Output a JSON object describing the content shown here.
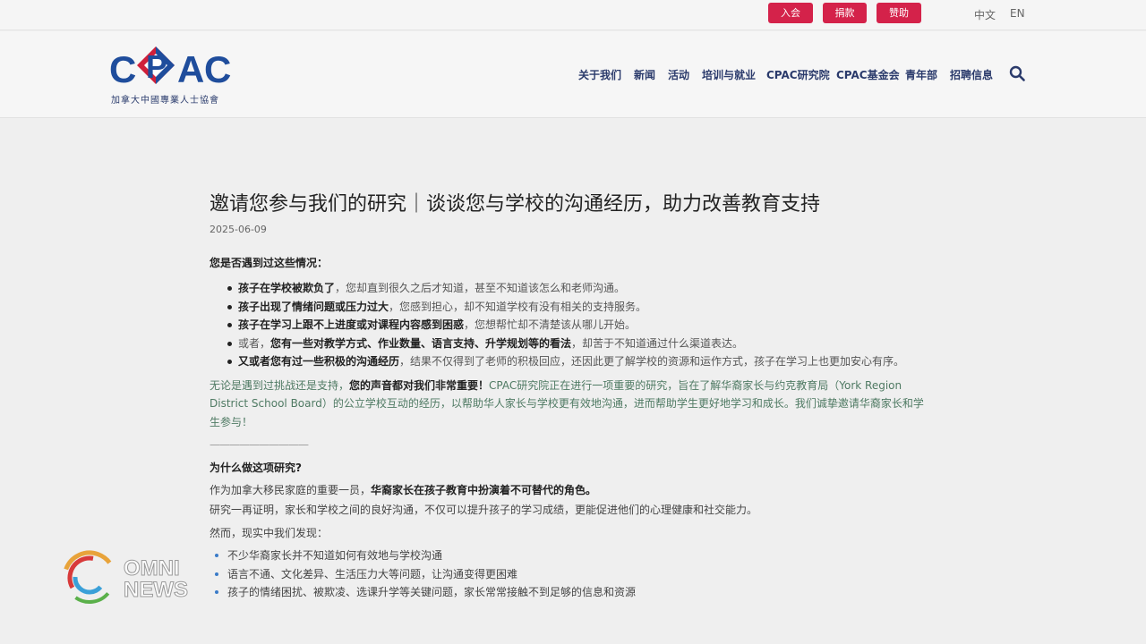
{
  "topbar": {
    "buttons": [
      "入会",
      "捐款",
      "赞助"
    ],
    "lang_zh": "中文",
    "lang_en": "EN"
  },
  "header": {
    "logo_text": "CPAC",
    "logo_sub": "加拿大中國專業人士協會",
    "nav": [
      "关于我们",
      "新闻",
      "活动",
      "培训与就业",
      "CPAC研究院",
      "CPAC基金会",
      "青年部",
      "招聘信息"
    ],
    "search_icon": "search-icon"
  },
  "article": {
    "title": "邀请您参与我们的研究｜谈谈您与学校的沟通经历，助力改善教育支持",
    "date": "2025-06-09",
    "q1": "您是否遇到过这些情况：",
    "bullets": [
      {
        "bold": "孩子在学校被欺负了",
        "rest": "，您却直到很久之后才知道，甚至不知道该怎么和老师沟通。"
      },
      {
        "bold": "孩子出现了情绪问题或压力过大",
        "rest": "，您感到担心，却不知道学校有没有相关的支持服务。"
      },
      {
        "bold": "孩子在学习上跟不上进度或对课程内容感到困惑",
        "rest": "，您想帮忙却不清楚该从哪儿开始。"
      },
      {
        "pre": "或者，",
        "bold": "您有一些对教学方式、作业数量、语言支持、升学规划等的看法",
        "rest": "，却苦于不知道通过什么渠道表达。"
      },
      {
        "bold": "又或者您有过一些积极的沟通经历",
        "rest": "，结果不仅得到了老师的积极回应，还因此更了解学校的资源和运作方式，孩子在学习上也更加安心有序。"
      }
    ],
    "para_pre": "无论是遇到过挑战还是支持，",
    "para_bold": "您的声音都对我们非常重要！",
    "para_rest": "CPAC研究院正在进行一项重要的研究，旨在了解华裔家长与约克教育局（York Region District School Board）的公立学校互动的经历，以帮助华人家长与学校更有效地沟通，进而帮助学生更好地学习和成长。我们诚挚邀请华裔家长和学生参与！",
    "rule": "——————————",
    "q2": "为什么做这项研究?",
    "p2a_pre": "作为加拿大移民家庭的重要一员，",
    "p2a_bold": "华裔家长在孩子教育中扮演着不可替代的角色。",
    "p2b": "研究一再证明，家长和学校之间的良好沟通，不仅可以提升孩子的学习成绩，更能促进他们的心理健康和社交能力。",
    "p2c": "然而，现实中我们发现：",
    "findings": [
      "不少华裔家长并不知道如何有效地与学校沟通",
      "语言不通、文化差异、生活压力大等问题，让沟通变得更困难",
      "孩子的情绪困扰、被欺凌、选课升学等关键问题，家长常常接触不到足够的信息和资源"
    ]
  },
  "watermark": {
    "line1": "OMNI",
    "line2": "NEWS"
  },
  "colors": {
    "button_red": "#d4224a",
    "nav_blue": "#2a3a6b",
    "logo_blue": "#1f4d9c",
    "logo_red": "#d0203a",
    "link_green": "#4f7a63",
    "bullet_blue": "#3a7bc8"
  }
}
